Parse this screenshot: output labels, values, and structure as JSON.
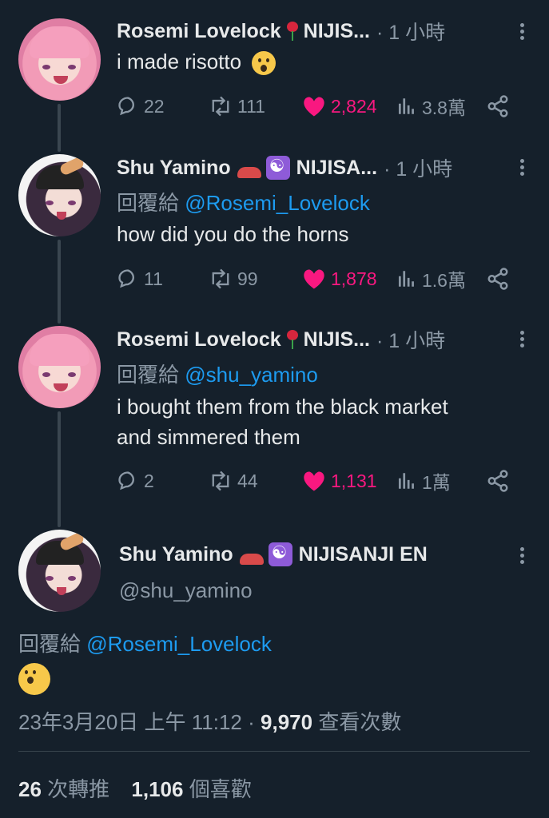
{
  "tweets": [
    {
      "author": "Rosemi Lovelock",
      "author_suffix": "NIJIS...",
      "time": "· 1 小時",
      "reply_prefix": "",
      "reply_handle": "",
      "text": "i made risotto",
      "replies": "22",
      "retweets": "111",
      "likes": "2,824",
      "views": "3.8萬"
    },
    {
      "author": "Shu Yamino",
      "author_suffix": "NIJISA...",
      "time": "· 1 小時",
      "reply_prefix": "回覆給",
      "reply_handle": "@Rosemi_Lovelock",
      "text": "how did you do the horns",
      "replies": "11",
      "retweets": "99",
      "likes": "1,878",
      "views": "1.6萬"
    },
    {
      "author": "Rosemi Lovelock",
      "author_suffix": "NIJIS...",
      "time": "· 1 小時",
      "reply_prefix": "回覆給",
      "reply_handle": "@shu_yamino",
      "text_line1": "i bought them from the black market",
      "text_line2": "and simmered them",
      "replies": "2",
      "retweets": "44",
      "likes": "1,131",
      "views": "1萬"
    }
  ],
  "focus": {
    "author": "Shu Yamino",
    "author_suffix": "NIJISANJI EN",
    "handle": "@shu_yamino",
    "reply_prefix": "回覆給",
    "reply_handle": "@Rosemi_Lovelock",
    "date": "23年3月20日 上午 11:12",
    "sep": "·",
    "views_count": "9,970",
    "views_label": "查看次數",
    "retweet_count": "26",
    "retweet_label": "次轉推",
    "like_count": "1,106",
    "like_label": "個喜歡"
  },
  "colors": {
    "background": "#15202b",
    "link": "#1d9bf0",
    "like": "#f91880",
    "muted": "#8b98a5"
  },
  "icons": [
    "reply-icon",
    "retweet-icon",
    "heart-icon",
    "views-icon",
    "share-icon",
    "more-icon",
    "rose-emoji",
    "yin-yang-emoji",
    "shoe-emoji",
    "astonished-emoji"
  ]
}
